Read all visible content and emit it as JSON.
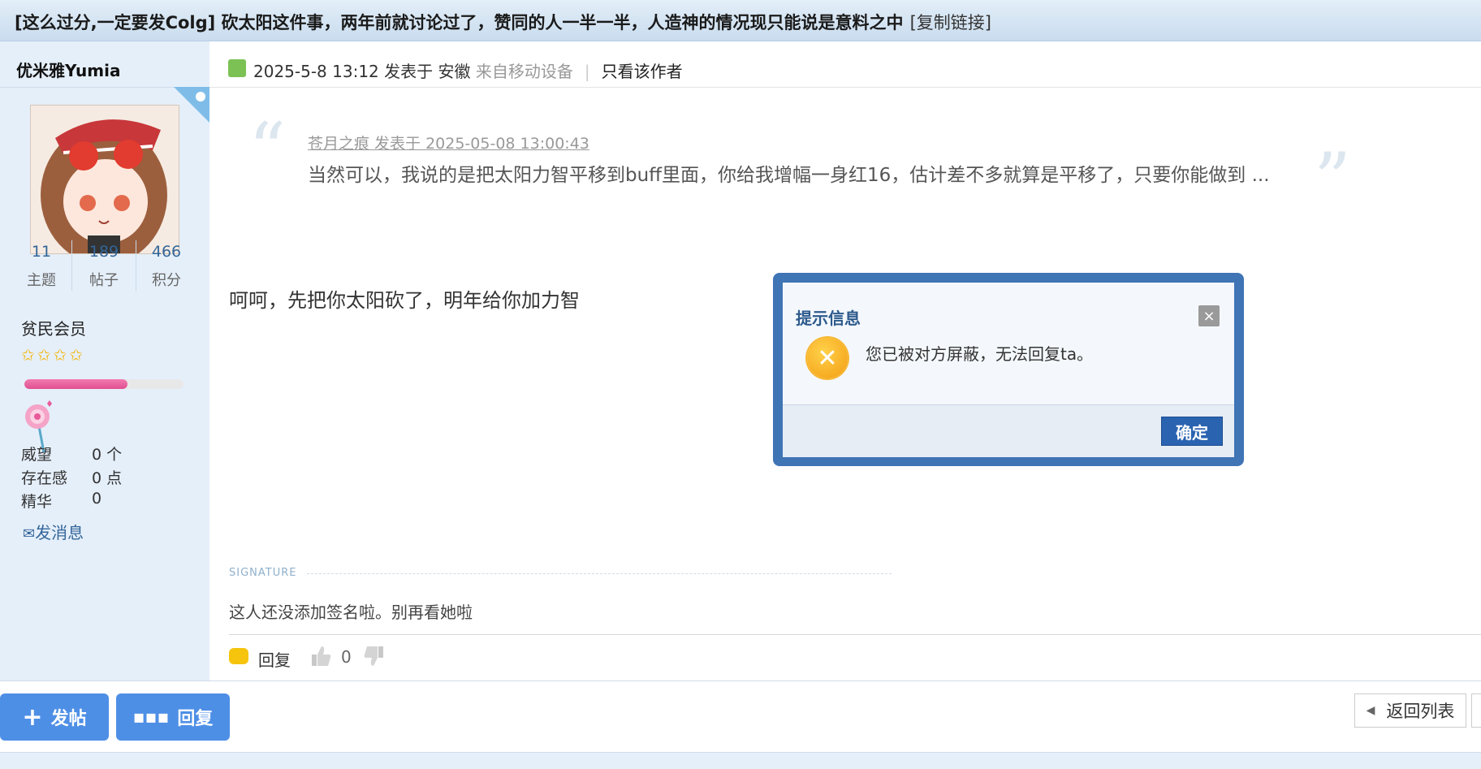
{
  "thread": {
    "title": "[这么过分,一定要发Colg] 砍太阳这件事，两年前就讨论过了，赞同的人一半一半，人造神的情况现只能说是意料之中",
    "copy_link": "[复制链接]"
  },
  "user": {
    "name": "优米雅Yumia",
    "stats": [
      {
        "value": "11",
        "label": "主题"
      },
      {
        "value": "189",
        "label": "帖子"
      },
      {
        "value": "466",
        "label": "积分"
      }
    ],
    "group": "贫民会员",
    "stars": "✩✩✩✩",
    "level_progress": 0.65,
    "extra": [
      {
        "label": "威望",
        "value": "0 个"
      },
      {
        "label": "存在感",
        "value": "0 点"
      },
      {
        "label": "精华",
        "value": "0"
      }
    ],
    "send_message": "发消息"
  },
  "post": {
    "datetime": "2025-5-8 13:12",
    "posted_in": "发表于 安徽",
    "from_mobile": "来自移动设备",
    "only_author": "只看该作者",
    "quote_author": "苍月之痕 发表于 2025-05-08 13:00:43",
    "quote_text": "当然可以，我说的是把太阳力智平移到buff里面，你给我增幅一身红16，估计差不多就算是平移了，只要你能做到 ...",
    "body": "呵呵，先把你太阳砍了，明年给你加力智",
    "signature_label": "SIGNATURE",
    "signature": "这人还没添加签名啦。别再看她啦",
    "reply_label": "回复",
    "like_count": "0"
  },
  "bottom": {
    "new_post": "发帖",
    "reply": "回复",
    "back_to_list": "返回列表"
  },
  "dialog": {
    "title": "提示信息",
    "message": "您已被对方屏蔽，无法回复ta。",
    "ok": "确定",
    "close": "×"
  },
  "colors": {
    "accent": "#4e8fe6",
    "sidebar_bg": "#e5effa",
    "dialog_border": "#3f74b5",
    "level_fill": "#e04f90"
  }
}
